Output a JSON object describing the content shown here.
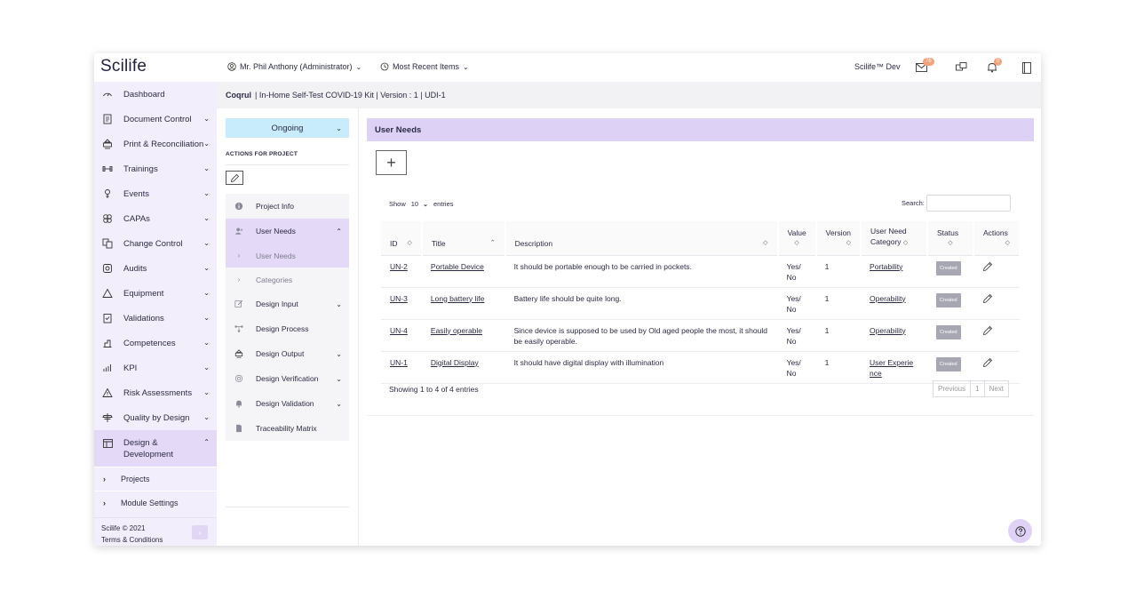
{
  "header": {
    "logo": "Scilife",
    "user_label": "Mr. Phil Anthony (Administrator)",
    "recent_label": "Most Recent Items",
    "env_label": "Scilife™ Dev",
    "mail_badge": "76",
    "notif_badge": "0"
  },
  "sidebar": {
    "items": [
      {
        "label": "Dashboard",
        "icon": "dashboard-icon",
        "chevron": ""
      },
      {
        "label": "Document Control",
        "icon": "document-icon",
        "chevron": "⌄"
      },
      {
        "label": "Print & Reconciliation",
        "icon": "print-icon",
        "chevron": "⌄"
      },
      {
        "label": "Trainings",
        "icon": "training-icon",
        "chevron": "⌄"
      },
      {
        "label": "Events",
        "icon": "events-icon",
        "chevron": "⌄"
      },
      {
        "label": "CAPAs",
        "icon": "capa-icon",
        "chevron": "⌄"
      },
      {
        "label": "Change Control",
        "icon": "change-control-icon",
        "chevron": "⌄"
      },
      {
        "label": "Audits",
        "icon": "audits-icon",
        "chevron": "⌄"
      },
      {
        "label": "Equipment",
        "icon": "equipment-icon",
        "chevron": "⌄"
      },
      {
        "label": "Validations",
        "icon": "validations-icon",
        "chevron": "⌄"
      },
      {
        "label": "Competences",
        "icon": "competences-icon",
        "chevron": "⌄"
      },
      {
        "label": "KPI",
        "icon": "kpi-icon",
        "chevron": "⌄"
      },
      {
        "label": "Risk Assessments",
        "icon": "risk-icon",
        "chevron": "⌄"
      },
      {
        "label": "Quality by Design",
        "icon": "quality-icon",
        "chevron": "⌄"
      }
    ],
    "active": {
      "label_line1": "Design &",
      "label_line2": "Development",
      "chevron": "⌃"
    },
    "subs": [
      {
        "label": "Projects"
      },
      {
        "label": "Module Settings"
      }
    ],
    "footer_line1": "Scilife © 2021",
    "footer_line2": "Terms & Conditions"
  },
  "breadcrumb": {
    "project": "Coqrul",
    "rest": "| In-Home Self-Test COVID-19 Kit | Version : 1 | UDI-1"
  },
  "project_panel": {
    "status": "Ongoing",
    "actions_title": "ACTIONS FOR PROJECT",
    "menu": [
      {
        "label": "Project Info",
        "icon": "info-icon",
        "chevron": "",
        "kind": "item"
      },
      {
        "label": "User Needs",
        "icon": "user-add-icon",
        "chevron": "⌃",
        "kind": "active"
      },
      {
        "label": "User Needs",
        "icon": "",
        "chevron": "",
        "kind": "sub-active"
      },
      {
        "label": "Categories",
        "icon": "",
        "chevron": "",
        "kind": "sub"
      },
      {
        "label": "Design Input",
        "icon": "edit-icon",
        "chevron": "⌄",
        "kind": "item"
      },
      {
        "label": "Design Process",
        "icon": "process-icon",
        "chevron": "",
        "kind": "item"
      },
      {
        "label": "Design Output",
        "icon": "print-icon",
        "chevron": "⌄",
        "kind": "item"
      },
      {
        "label": "Design Verification",
        "icon": "target-icon",
        "chevron": "⌄",
        "kind": "item"
      },
      {
        "label": "Design Validation",
        "icon": "bell-icon",
        "chevron": "⌄",
        "kind": "item"
      },
      {
        "label": "Traceability Matrix",
        "icon": "file-icon",
        "chevron": "",
        "kind": "item"
      }
    ]
  },
  "main": {
    "title": "User Needs",
    "show_label": "Show",
    "page_size": "10",
    "entries_label": "entries",
    "search_label": "Search:",
    "columns": [
      "ID",
      "Title",
      "Description",
      "Value",
      "Version",
      "User Need Category",
      "Status",
      "Actions"
    ],
    "rows": [
      {
        "id": "UN-2",
        "title": "Portable Device",
        "description": "It should be portable enough to be carried in pockets.",
        "value": "Yes/ No",
        "version": "1",
        "category": "Portability",
        "status": "Created"
      },
      {
        "id": "UN-3",
        "title": "Long battery life",
        "description": "Battery life should be quite long.",
        "value": "Yes/ No",
        "version": "1",
        "category": "Operability",
        "status": "Created"
      },
      {
        "id": "UN-4",
        "title": "Easily operable",
        "description": "Since device is supposed to be used by Old aged people the most, it should be easily operable.",
        "value": "Yes/ No",
        "version": "1",
        "category": "Operability",
        "status": "Created"
      },
      {
        "id": "UN-1",
        "title": "Digital Display",
        "description": "It should have digital display with illumination",
        "value": "Yes/ No",
        "version": "1",
        "category": "User Experie nce",
        "status": "Created"
      }
    ],
    "info": "Showing 1 to 4 of 4 entries",
    "pager": {
      "prev": "Previous",
      "page": "1",
      "next": "Next"
    }
  }
}
